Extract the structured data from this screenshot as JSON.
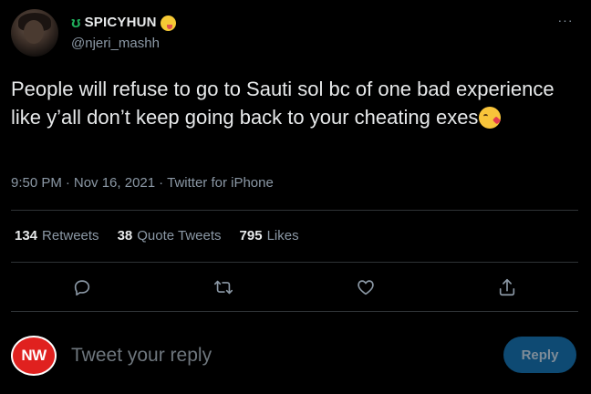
{
  "author": {
    "display_name": "SPICYHUN",
    "handle": "@njeri_mashh",
    "name_prefix_icon": "swirl-icon",
    "name_suffix_icon": "zany-face-emoji"
  },
  "tweet": {
    "text": "People will refuse to go to Sauti sol bc of one bad experience like y’all don’t keep going back to your cheating exes",
    "trailing_emoji": "face-blowing-kiss-emoji",
    "time": "9:50 PM",
    "date": "Nov 16, 2021",
    "separator": "·",
    "source": "Twitter for iPhone"
  },
  "stats": {
    "retweets_count": "134",
    "retweets_label": "Retweets",
    "quote_count": "38",
    "quote_label": "Quote Tweets",
    "likes_count": "795",
    "likes_label": "Likes"
  },
  "more_label": "···",
  "reply": {
    "avatar_text": "NW",
    "placeholder": "Tweet your reply",
    "button_label": "Reply"
  },
  "colors": {
    "background": "#000000",
    "text": "#e7e9ea",
    "muted": "#8b98a5",
    "divider": "#2f3336",
    "reply_button": "#0e4a73"
  }
}
